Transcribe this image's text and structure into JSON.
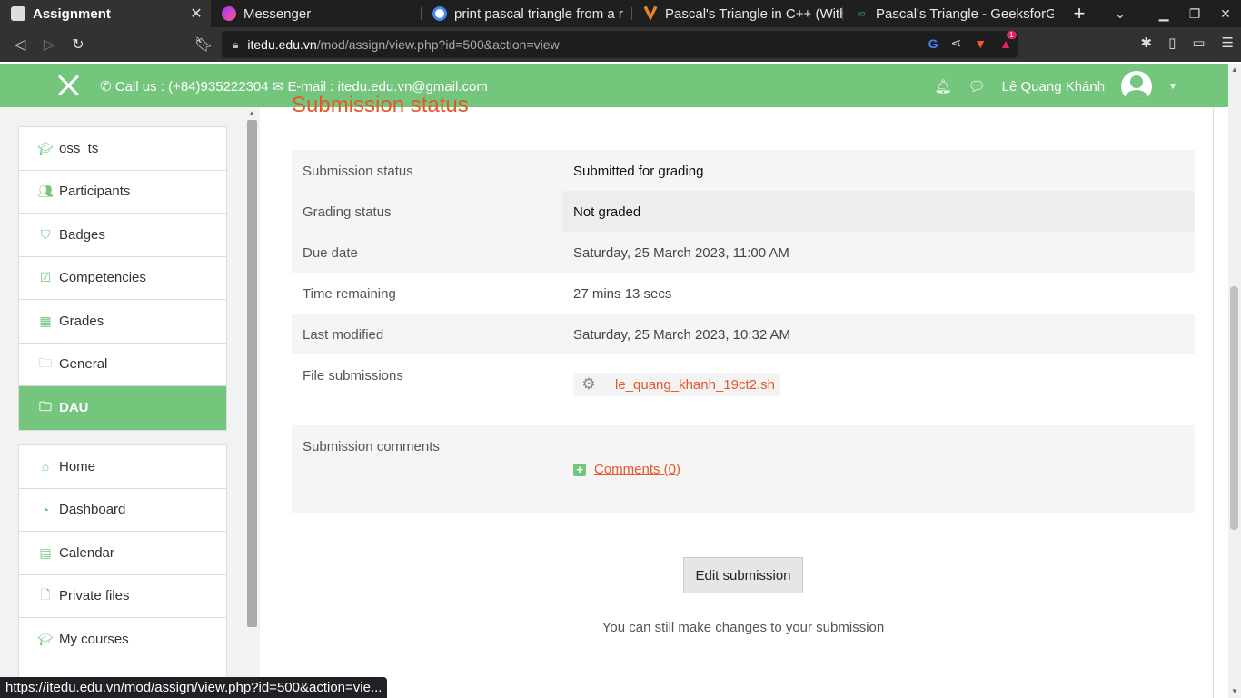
{
  "browser": {
    "tabs": [
      {
        "title": "Assignment",
        "active": true,
        "icon": "moodle-favicon-icon"
      },
      {
        "title": "Messenger",
        "active": false,
        "icon": "messenger-icon"
      },
      {
        "title": "print pascal triangle from a r",
        "active": false,
        "icon": "google-icon"
      },
      {
        "title": "Pascal's Triangle in C++ (With",
        "active": false,
        "icon": "tutorial-site-icon"
      },
      {
        "title": "Pascal's Triangle - GeeksforG",
        "active": false,
        "icon": "geeksforgeeks-icon"
      }
    ],
    "url_host": "itedu.edu.vn",
    "url_path": "/mod/assign/view.php?id=500&action=view",
    "status_url": "https://itedu.edu.vn/mod/assign/view.php?id=500&action=vie...",
    "brave_badge": "1"
  },
  "header": {
    "phone": "Call us : (+84)935222304",
    "email": "E-mail : itedu.edu.vn@gmail.com",
    "user_name": "Lê Quang Khánh"
  },
  "sidebar": {
    "course_items": [
      {
        "label": "oss_ts",
        "icon": "graduation-cap-icon"
      },
      {
        "label": "Participants",
        "icon": "users-icon"
      },
      {
        "label": "Badges",
        "icon": "shield-icon"
      },
      {
        "label": "Competencies",
        "icon": "check-square-icon"
      },
      {
        "label": "Grades",
        "icon": "table-icon"
      },
      {
        "label": "General",
        "icon": "folder-icon"
      },
      {
        "label": "DAU",
        "icon": "folder-icon",
        "active": true
      }
    ],
    "site_items": [
      {
        "label": "Home",
        "icon": "home-icon"
      },
      {
        "label": "Dashboard",
        "icon": "dashboard-icon"
      },
      {
        "label": "Calendar",
        "icon": "calendar-icon"
      },
      {
        "label": "Private files",
        "icon": "file-icon"
      },
      {
        "label": "My courses",
        "icon": "graduation-cap-icon"
      }
    ]
  },
  "main": {
    "section_title": "Submission status",
    "rows": [
      {
        "label": "Submission status",
        "value": "Submitted for grading"
      },
      {
        "label": "Grading status",
        "value": "Not graded"
      },
      {
        "label": "Due date",
        "value": "Saturday, 25 March 2023, 11:00 AM"
      },
      {
        "label": "Time remaining",
        "value": "27 mins 13 secs"
      },
      {
        "label": "Last modified",
        "value": "Saturday, 25 March 2023, 10:32 AM"
      }
    ],
    "file_submissions_label": "File submissions",
    "file_name": "le_quang_khanh_19ct2.sh",
    "comments_label": "Submission comments",
    "comments_link": "Comments (0)",
    "edit_button": "Edit submission",
    "hint": "You can still make changes to your submission"
  },
  "colors": {
    "brand_green": "#74c67d",
    "accent_orange": "#e8562a"
  }
}
